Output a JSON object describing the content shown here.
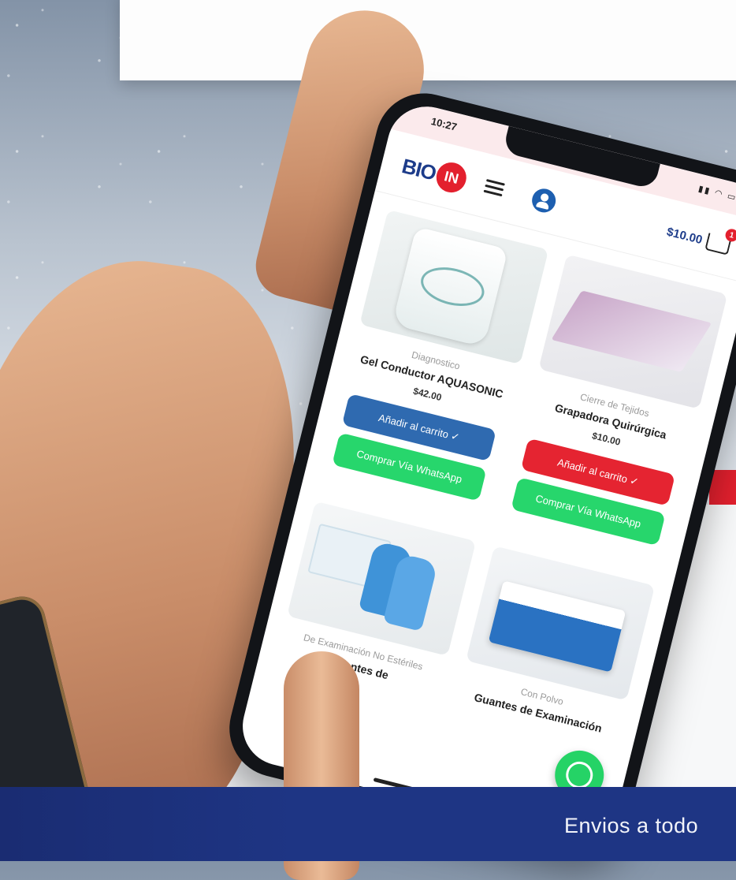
{
  "page": {
    "banner_text": "Envios a todo"
  },
  "phone": {
    "status": {
      "time": "10:27",
      "icons": "signal-icon wifi-icon battery-icon"
    },
    "header": {
      "logo_bio": "BIO",
      "logo_in": "IN",
      "cart_total": "$10.00",
      "cart_count": "1"
    },
    "products": [
      {
        "category": "Diagnostico",
        "name": "Gel Conductor AQUASONIC",
        "price": "$42.00",
        "add_to_cart": "Añadir al carrito ✓",
        "whatsapp": "Comprar Vía WhatsApp"
      },
      {
        "category": "Cierre de Tejidos",
        "name": "Grapadora Quirúrgica",
        "price": "$10.00",
        "add_to_cart": "Añadir al carrito ✓",
        "whatsapp": "Comprar Vía WhatsApp"
      },
      {
        "category": "De Examinación No Estériles",
        "name": "Guantes de",
        "price": "",
        "add_to_cart": "",
        "whatsapp": ""
      },
      {
        "category": "Con Polvo",
        "name": "Guantes de Examinación",
        "price": "",
        "add_to_cart": "",
        "whatsapp": ""
      }
    ]
  },
  "colors": {
    "brand_blue": "#1d3c8a",
    "brand_red": "#e3202e",
    "whatsapp_green": "#27d66c",
    "banner_blue": "#1e3584"
  }
}
